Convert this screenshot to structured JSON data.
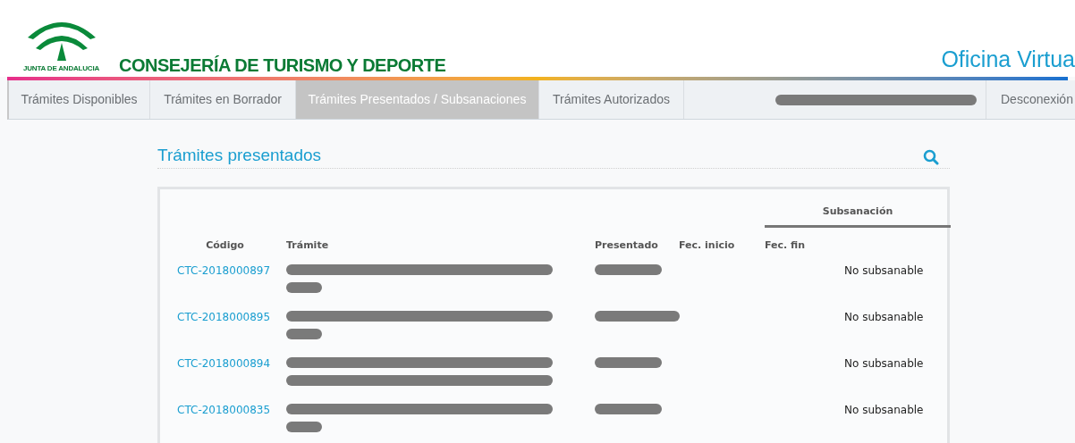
{
  "header": {
    "logo_caption": "JUNTA DE ANDALUCIA",
    "department": "CONSEJERÍA DE TURISMO Y DEPORTE",
    "portal": "Oficina Virtua"
  },
  "nav": {
    "tabs": [
      {
        "label": "Trámites Disponibles",
        "selected": false
      },
      {
        "label": "Trámites en Borrador",
        "selected": false
      },
      {
        "label": "Trámites Presentados / Subsanaciones",
        "selected": true
      },
      {
        "label": "Trámites Autorizados",
        "selected": false
      }
    ],
    "user_redacted": true,
    "logout": "Desconexión"
  },
  "section": {
    "title": "Trámites presentados"
  },
  "table": {
    "group_header": "Subsanación",
    "columns": [
      "Código",
      "Trámite",
      "Presentado",
      "Fec. inicio",
      "Fec. fin"
    ],
    "rows": [
      {
        "code": "CTC-2018000897",
        "tramite_marks": [
          {
            "kind": "long"
          },
          {
            "kind": "short"
          }
        ],
        "presentado_mark": {
          "kind": "short"
        },
        "status": "No subsanable"
      },
      {
        "code": "CTC-2018000895",
        "tramite_marks": [
          {
            "kind": "long"
          },
          {
            "kind": "short"
          }
        ],
        "presentado_mark": {
          "kind": "medium"
        },
        "status": "No subsanable"
      },
      {
        "code": "CTC-2018000894",
        "tramite_marks": [
          {
            "kind": "long"
          },
          {
            "kind": "long"
          }
        ],
        "presentado_mark": {
          "kind": "short"
        },
        "status": "No subsanable"
      },
      {
        "code": "CTC-2018000835",
        "tramite_marks": [
          {
            "kind": "long"
          },
          {
            "kind": "short"
          }
        ],
        "presentado_mark": {
          "kind": "short"
        },
        "status": "No subsanable"
      }
    ]
  }
}
